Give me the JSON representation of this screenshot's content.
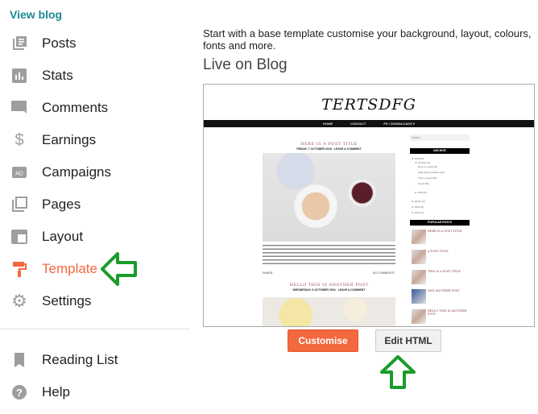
{
  "sidebar": {
    "view_blog": "View blog",
    "items": [
      {
        "label": "Posts",
        "icon": "posts-icon"
      },
      {
        "label": "Stats",
        "icon": "stats-icon"
      },
      {
        "label": "Comments",
        "icon": "comments-icon"
      },
      {
        "label": "Earnings",
        "icon": "dollar-icon"
      },
      {
        "label": "Campaigns",
        "icon": "ad-icon"
      },
      {
        "label": "Pages",
        "icon": "pages-icon"
      },
      {
        "label": "Layout",
        "icon": "layout-icon"
      },
      {
        "label": "Template",
        "icon": "paint-roller-icon",
        "active": true
      },
      {
        "label": "Settings",
        "icon": "gear-icon"
      }
    ],
    "bottom_items": [
      {
        "label": "Reading List",
        "icon": "bookmark-icon"
      },
      {
        "label": "Help",
        "icon": "help-icon"
      }
    ]
  },
  "main": {
    "intro": "Start with a base template customise your background, layout, colours, fonts and more.",
    "live_heading": "Live on Blog",
    "preview": {
      "blog_title": "TERTSDFG",
      "nav": [
        "HOME",
        "CONTACT",
        "PE / DOWNLOADS ▾"
      ],
      "posts": [
        {
          "title": "HERE IS A POST TITLE",
          "meta": "FRIDAY, 7 OCTOBER 2016 · LEAVE A COMMENT"
        },
        {
          "title": "HELLO THIS IS ANOTHER POST",
          "meta": "WEDNESDAY, 5 OCTOBER 2016 · LEAVE A COMMENT"
        }
      ],
      "share": "SHARE:",
      "no_comments": "NO COMMENTS",
      "search_placeholder": "Search",
      "archive_heading": "ARCHIVE",
      "archive": [
        "▼ 2016 (9)",
        "▼ October (4)",
        "Here is a post title",
        "Hello this is another post",
        "This is a post title",
        "A post title",
        "► 2016 (5)",
        "► 2015 (14)",
        "► 2014 (9)",
        "► 2013 (4)"
      ],
      "popular_heading": "POPULAR POSTS",
      "popular": [
        "HERE IS A POST TITLE",
        "A POST TITLE",
        "THIS IS A POST TITLE",
        "AND ANOTHER POST",
        "HELLO THIS IS ANOTHER POST"
      ]
    },
    "customise_label": "Customise",
    "edit_html_label": "Edit HTML"
  },
  "colors": {
    "accent": "#f4683f",
    "link": "#1a8a93",
    "annotation_arrow": "#1a9c2a"
  }
}
